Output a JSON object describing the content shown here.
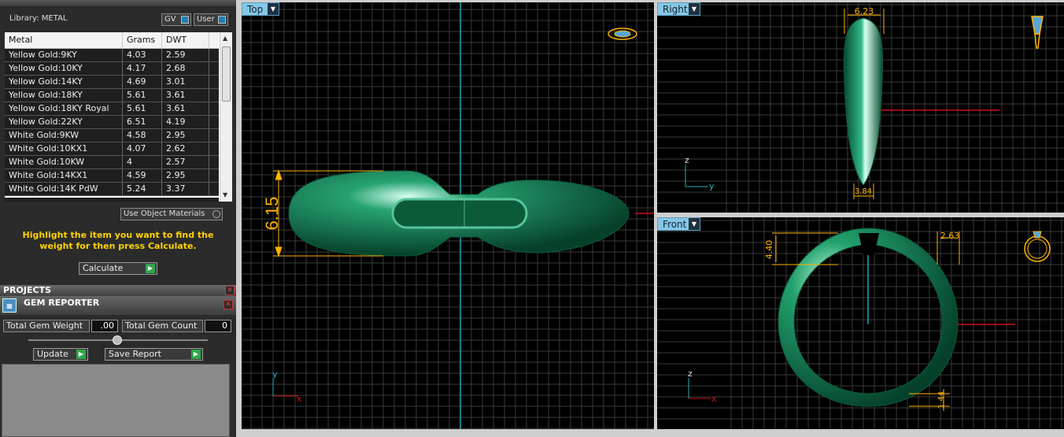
{
  "library": {
    "title": "Library: METAL",
    "gv_label": "GV",
    "user_label": "User"
  },
  "metal_table": {
    "headers": [
      "Metal",
      "Grams",
      "DWT"
    ],
    "rows": [
      [
        "Yellow Gold:9KY",
        "4.03",
        "2.59"
      ],
      [
        "Yellow Gold:10KY",
        "4.17",
        "2.68"
      ],
      [
        "Yellow Gold:14KY",
        "4.69",
        "3.01"
      ],
      [
        "Yellow Gold:18KY",
        "5.61",
        "3.61"
      ],
      [
        "Yellow Gold:18KY Royal",
        "5.61",
        "3.61"
      ],
      [
        "Yellow Gold:22KY",
        "6.51",
        "4.19"
      ],
      [
        "White Gold:9KW",
        "4.58",
        "2.95"
      ],
      [
        "White Gold:10KX1",
        "4.07",
        "2.62"
      ],
      [
        "White Gold:10KW",
        "4",
        "2.57"
      ],
      [
        "White Gold:14KX1",
        "4.59",
        "2.95"
      ],
      [
        "White Gold:14K PdW",
        "5.24",
        "3.37"
      ]
    ]
  },
  "use_object_materials": "Use Object Materials",
  "hint": "Highlight the item you want to find the weight for then press Calculate.",
  "calculate_label": "Calculate",
  "projects": {
    "title": "PROJECTS"
  },
  "gem_reporter": {
    "title": "GEM REPORTER",
    "total_weight_label": "Total Gem Weight",
    "total_weight_value": ".00",
    "total_count_label": "Total Gem Count",
    "total_count_value": "0",
    "update_label": "Update",
    "save_report_label": "Save Report"
  },
  "viewports": {
    "top": {
      "label": "Top",
      "dim": "6.15",
      "axis_y": "y",
      "axis_x": "x"
    },
    "right": {
      "label": "Right",
      "dim_top": "6.23",
      "dim_bottom": "3.84",
      "axis_z": "z",
      "axis_y": "y"
    },
    "front": {
      "label": "Front",
      "dim_left": "4.40",
      "dim_right": "2.63",
      "dim_bottom": "1.44",
      "axis_z": "z",
      "axis_x": "x"
    }
  },
  "colors": {
    "accent": "#86c7e6",
    "dimension": "#ffb400",
    "model": "#0f7a4e",
    "grid": "#3a3a3a"
  }
}
